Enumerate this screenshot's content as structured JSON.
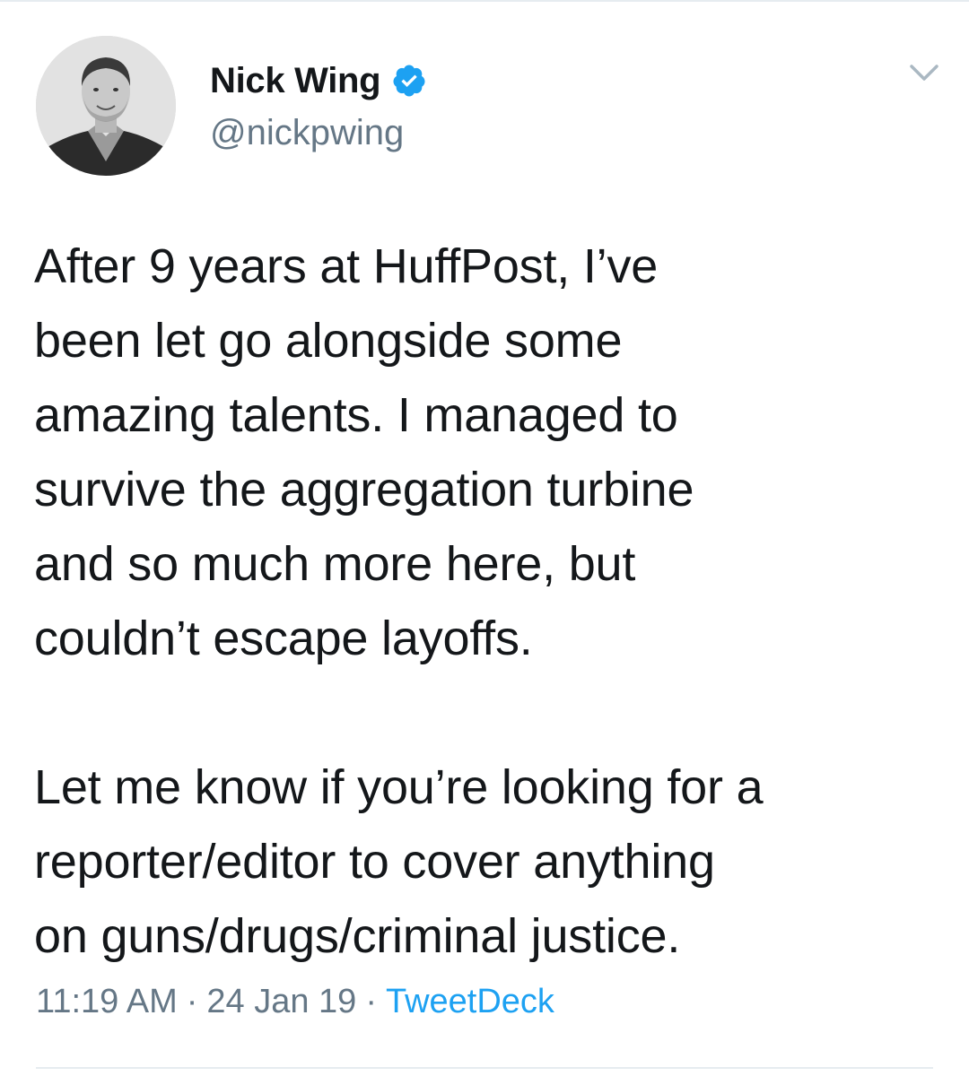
{
  "author": {
    "display_name": "Nick Wing",
    "handle": "@nickpwing",
    "verified": true,
    "avatar_icon": "profile-photo"
  },
  "tweet": {
    "paragraphs": [
      "After 9 years at HuffPost, I’ve\nbeen let go alongside some\namazing talents. I managed to\nsurvive the aggregation turbine\nand so much more here, but\ncouldn’t escape layoffs.",
      "Let me know if you’re looking for a\nreporter/editor to cover anything\non guns/drugs/criminal justice."
    ],
    "time": "11:19 AM",
    "date": "24 Jan 19",
    "source": "TweetDeck",
    "separator": "·"
  },
  "icons": {
    "verified_badge": "verified-badge-icon",
    "menu": "chevron-down-icon"
  },
  "colors": {
    "text_primary": "#14171a",
    "text_secondary": "#657786",
    "accent": "#1da1f2",
    "border": "#e6ecf0"
  }
}
